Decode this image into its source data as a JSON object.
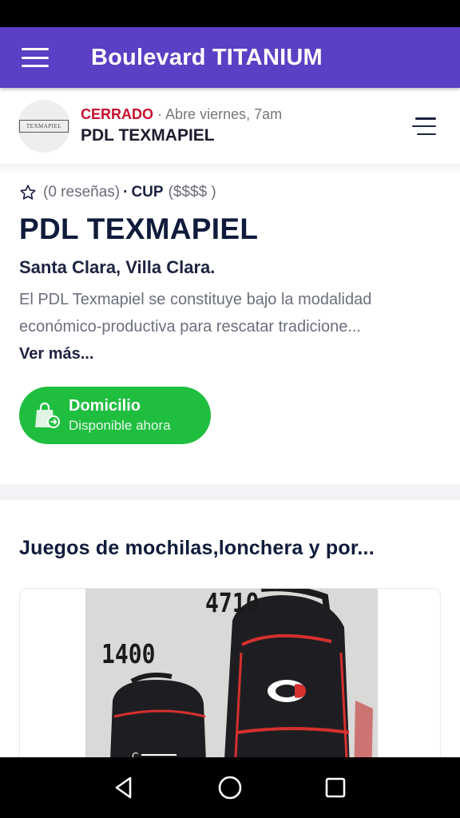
{
  "app_bar": {
    "title": "Boulevard TITANIUM",
    "color": "#5b3fc4"
  },
  "store_header": {
    "logo_text": "TEXMAPIEL",
    "status": "CERRADO",
    "separator": "·",
    "opens": "Abre viernes, 7am",
    "name": "PDL TEXMAPIEL"
  },
  "details": {
    "reviews": "(0 reseñas)",
    "dot": "·",
    "currency": "CUP",
    "price_level": "($$$$ )",
    "title": "PDL TEXMAPIEL",
    "location": "Santa Clara, Villa Clara.",
    "description": "El PDL Texmapiel se constituye bajo la modalidad económico-productiva para rescatar tradicione...",
    "more_link": "Ver más..."
  },
  "delivery": {
    "title": "Domicilio",
    "subtitle": "Disponible ahora",
    "icon": "shopping-bag-icon",
    "color": "#1fbe3f"
  },
  "products": {
    "heading": "Juegos de mochilas,lonchera y por...",
    "items": [
      {
        "tag_large": "4710",
        "tag_small": "1400"
      }
    ]
  },
  "nav": {
    "back": "back-icon",
    "home": "home-icon",
    "recents": "recents-icon"
  }
}
